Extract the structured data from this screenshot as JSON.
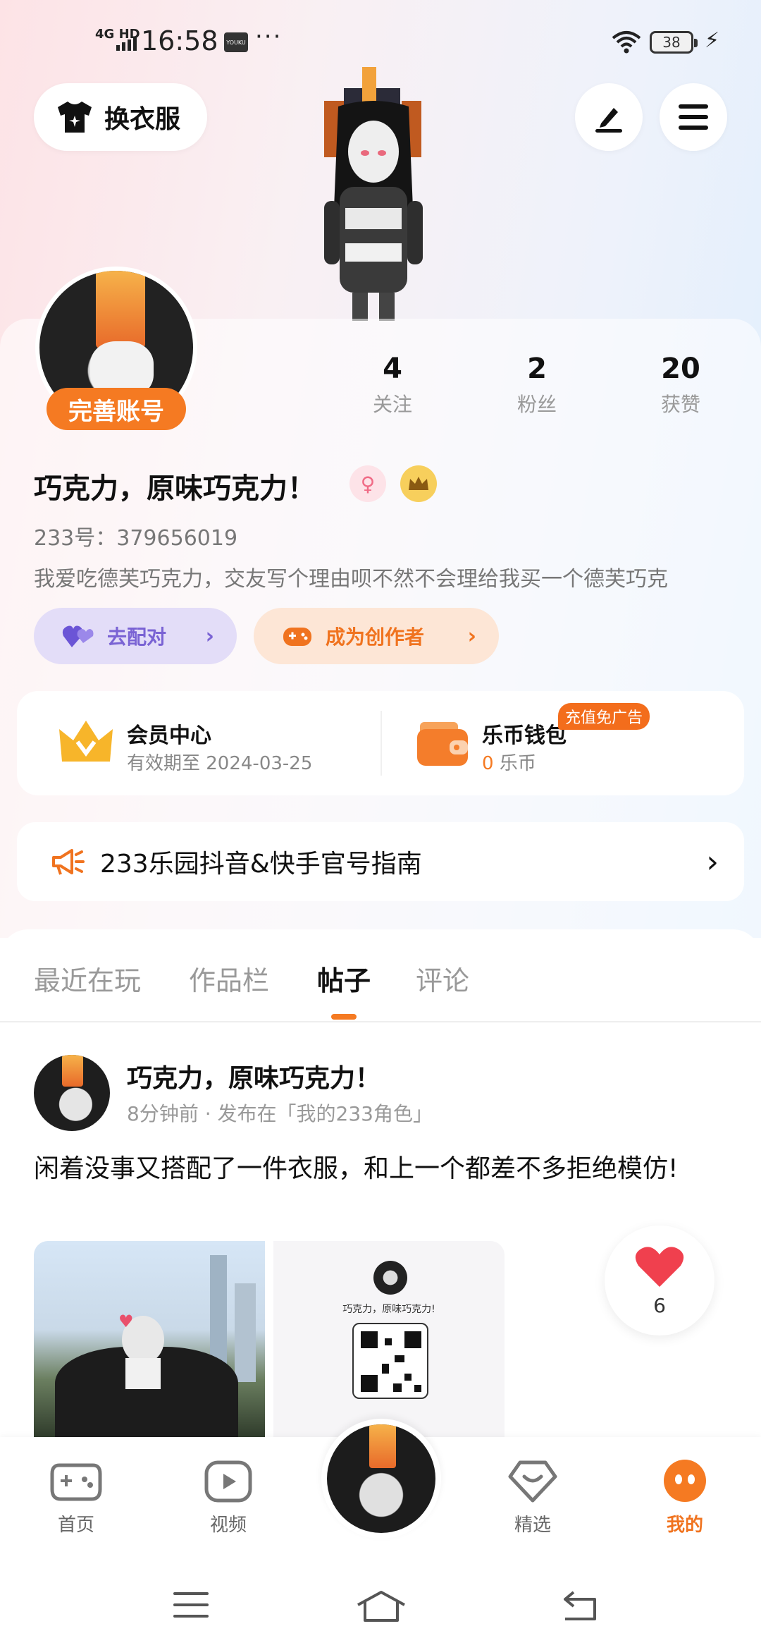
{
  "status_bar": {
    "network": "4G HD",
    "time": "16:58",
    "app_icon": "YOUKU",
    "more": "···",
    "battery": "38"
  },
  "header": {
    "outfit_button": "换衣服",
    "edit_icon": "pen-icon",
    "menu_icon": "hamburger-icon"
  },
  "profile": {
    "complete_badge": "完善账号",
    "stats": [
      {
        "value": "4",
        "label": "关注"
      },
      {
        "value": "2",
        "label": "粉丝"
      },
      {
        "value": "20",
        "label": "获赞"
      }
    ],
    "username": "巧克力，原味巧克力！",
    "uid": "233号：379656019",
    "bio": "我爱吃德芙巧克力，交友写个理由呗不然不会理给我买一个德芙巧克",
    "match_button": "去配对",
    "creator_button": "成为创作者"
  },
  "member": {
    "title": "会员中心",
    "valid": "有效期至 2024-03-25",
    "wallet_title": "乐币钱包",
    "wallet_amount": "0",
    "wallet_unit": "乐币",
    "recharge_tag": "充值免广告"
  },
  "notice": {
    "text": "233乐园抖音&快手官号指南"
  },
  "tabs": [
    "最近在玩",
    "作品栏",
    "帖子",
    "评论"
  ],
  "active_tab": "帖子",
  "post": {
    "author": "巧克力，原味巧克力！",
    "meta": "8分钟前 · 发布在「我的233角色」",
    "text": "闲着没事又搭配了一件衣服，和上一个都差不多拒绝模仿!",
    "card_caption": "巧克力，原味巧克力!",
    "likes": "6"
  },
  "bottom_nav": [
    {
      "label": "首页"
    },
    {
      "label": "视频"
    },
    {
      "label": "精选"
    },
    {
      "label": "我的"
    }
  ],
  "colors": {
    "accent": "#f57a22",
    "purple": "#7a63d4"
  }
}
